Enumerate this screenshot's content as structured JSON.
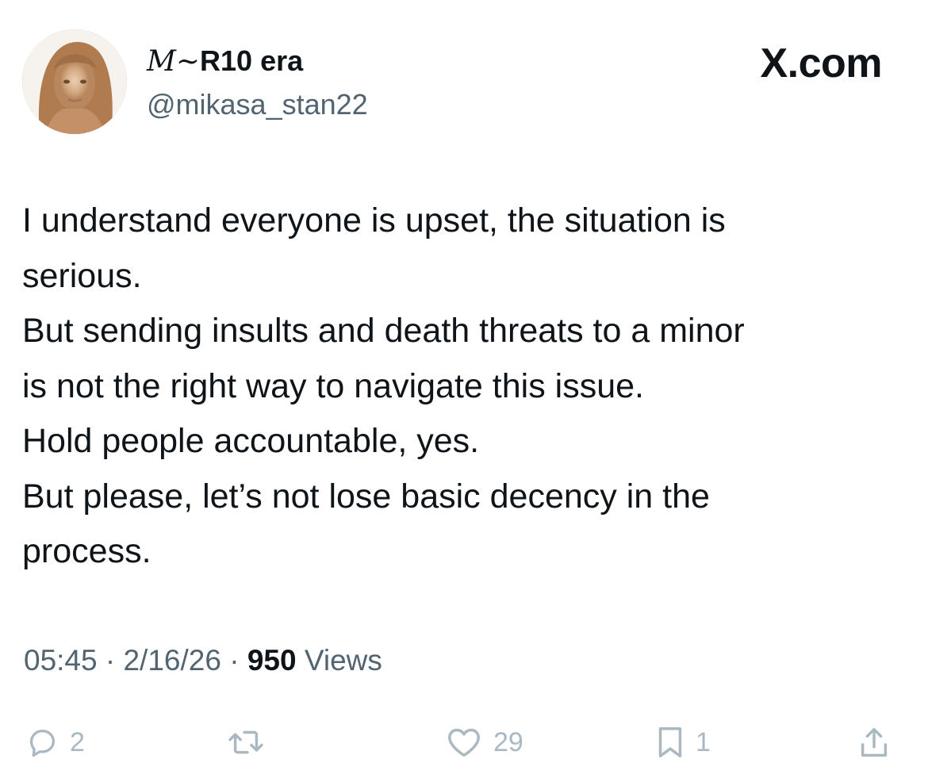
{
  "author": {
    "display_name_script": "M~",
    "display_name_rest": "R10 era",
    "handle": "@mikasa_stan22"
  },
  "brand": {
    "label": "X.com"
  },
  "tweet": {
    "lines": [
      "I understand everyone is upset, the situation is",
      "serious.",
      "But sending insults and death threats to a minor",
      "is not the right way to navigate this issue.",
      "Hold people accountable, yes.",
      "But please, let’s not lose basic decency in the",
      "process."
    ]
  },
  "meta": {
    "time": "05:45",
    "separator": "·",
    "date": "2/16/26",
    "views_count": "950",
    "views_label": "Views"
  },
  "actions": {
    "reply": {
      "icon": "reply-icon",
      "count": "2"
    },
    "retweet": {
      "icon": "retweet-icon",
      "count": ""
    },
    "like": {
      "icon": "heart-icon",
      "count": "29"
    },
    "bookmark": {
      "icon": "bookmark-icon",
      "count": "1"
    },
    "share": {
      "icon": "share-icon",
      "count": ""
    }
  },
  "colors": {
    "text_primary": "#0f1419",
    "text_secondary": "#536471",
    "action_muted": "#aab8c2",
    "background": "#ffffff"
  }
}
